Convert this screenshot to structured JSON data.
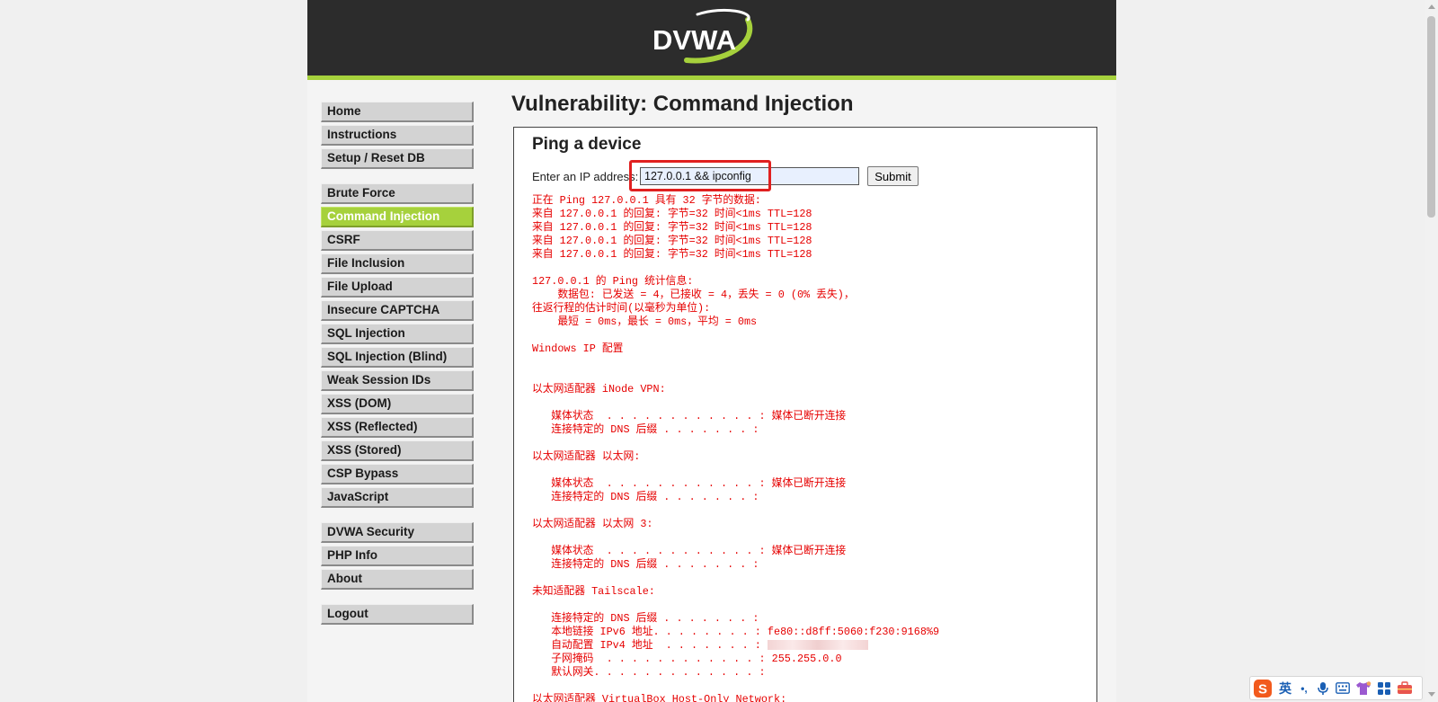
{
  "header": {
    "logo_text": "DVWA"
  },
  "menu": {
    "groups": [
      {
        "items": [
          {
            "label": "Home"
          },
          {
            "label": "Instructions"
          },
          {
            "label": "Setup / Reset DB"
          }
        ]
      },
      {
        "items": [
          {
            "label": "Brute Force"
          },
          {
            "label": "Command Injection",
            "selected": true
          },
          {
            "label": "CSRF"
          },
          {
            "label": "File Inclusion"
          },
          {
            "label": "File Upload"
          },
          {
            "label": "Insecure CAPTCHA"
          },
          {
            "label": "SQL Injection"
          },
          {
            "label": "SQL Injection (Blind)"
          },
          {
            "label": "Weak Session IDs"
          },
          {
            "label": "XSS (DOM)"
          },
          {
            "label": "XSS (Reflected)"
          },
          {
            "label": "XSS (Stored)"
          },
          {
            "label": "CSP Bypass"
          },
          {
            "label": "JavaScript"
          }
        ]
      },
      {
        "items": [
          {
            "label": "DVWA Security"
          },
          {
            "label": "PHP Info"
          },
          {
            "label": "About"
          }
        ]
      },
      {
        "items": [
          {
            "label": "Logout"
          }
        ]
      }
    ]
  },
  "main": {
    "title": "Vulnerability: Command Injection",
    "box": {
      "title": "Ping a device",
      "ip_label": "Enter an IP address:",
      "ip_value": "127.0.0.1 && ipconfig",
      "submit_label": "Submit"
    },
    "output_lines": [
      "正在 Ping 127.0.0.1 具有 32 字节的数据:",
      "来自 127.0.0.1 的回复: 字节=32 时间<1ms TTL=128",
      "来自 127.0.0.1 的回复: 字节=32 时间<1ms TTL=128",
      "来自 127.0.0.1 的回复: 字节=32 时间<1ms TTL=128",
      "来自 127.0.0.1 的回复: 字节=32 时间<1ms TTL=128",
      "",
      "127.0.0.1 的 Ping 统计信息:",
      "    数据包: 已发送 = 4，已接收 = 4，丢失 = 0 (0% 丢失)，",
      "往返行程的估计时间(以毫秒为单位):",
      "    最短 = 0ms，最长 = 0ms，平均 = 0ms",
      "",
      "Windows IP 配置",
      "",
      "",
      "以太网适配器 iNode VPN:",
      "",
      "   媒体状态  . . . . . . . . . . . . : 媒体已断开连接",
      "   连接特定的 DNS 后缀 . . . . . . . :",
      "",
      "以太网适配器 以太网:",
      "",
      "   媒体状态  . . . . . . . . . . . . : 媒体已断开连接",
      "   连接特定的 DNS 后缀 . . . . . . . :",
      "",
      "以太网适配器 以太网 3:",
      "",
      "   媒体状态  . . . . . . . . . . . . : 媒体已断开连接",
      "   连接特定的 DNS 后缀 . . . . . . . :",
      "",
      "未知适配器 Tailscale:",
      "",
      "   连接特定的 DNS 后缀 . . . . . . . :",
      "   本地链接 IPv6 地址. . . . . . . . : fe80::d8ff:5060:f230:9168%9",
      "   自动配置 IPv4 地址  . . . . . . . : [redacted]",
      "   子网掩码  . . . . . . . . . . . . : 255.255.0.0",
      "   默认网关. . . . . . . . . . . . . :",
      "",
      "以太网适配器 VirtualBox Host-Only Network:"
    ]
  },
  "ime": {
    "lang_label": "英",
    "punct_label": "•,"
  },
  "colors": {
    "accent": "#a6d13c",
    "header_bg": "#2c2c2c",
    "output_text": "#e60000",
    "highlight": "#e02020"
  },
  "icons": {
    "logo": "dvwa-swoosh-logo",
    "ime": [
      "sogou-s-icon",
      "microphone-icon",
      "keyboard-icon",
      "skin-shirt-icon",
      "grid-apps-icon",
      "toolbox-icon"
    ]
  }
}
